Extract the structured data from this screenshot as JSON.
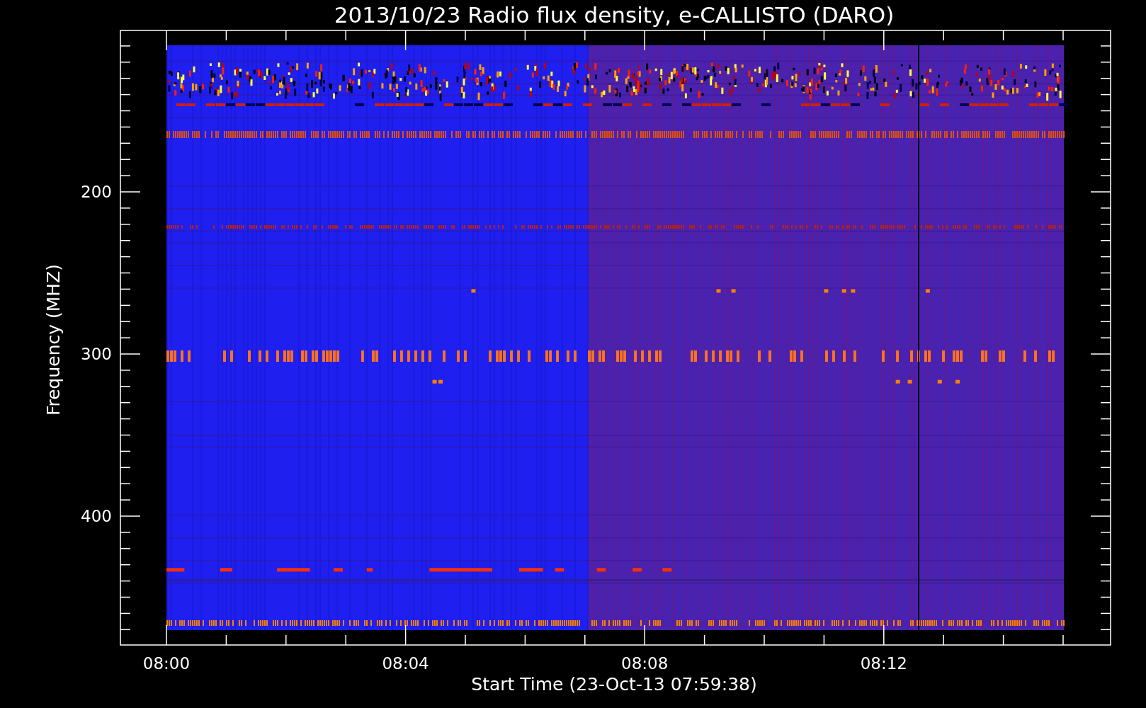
{
  "title": "2013/10/23  Radio flux density, e-CALLISTO (DARO)",
  "y_axis": {
    "label": "Frequency (MHZ)",
    "ticks": [
      "200",
      "300",
      "400"
    ]
  },
  "x_axis": {
    "label": "Start Time (23-Oct-13 07:59:38)",
    "ticks": [
      "08:00",
      "08:04",
      "08:08",
      "08:12"
    ]
  }
}
